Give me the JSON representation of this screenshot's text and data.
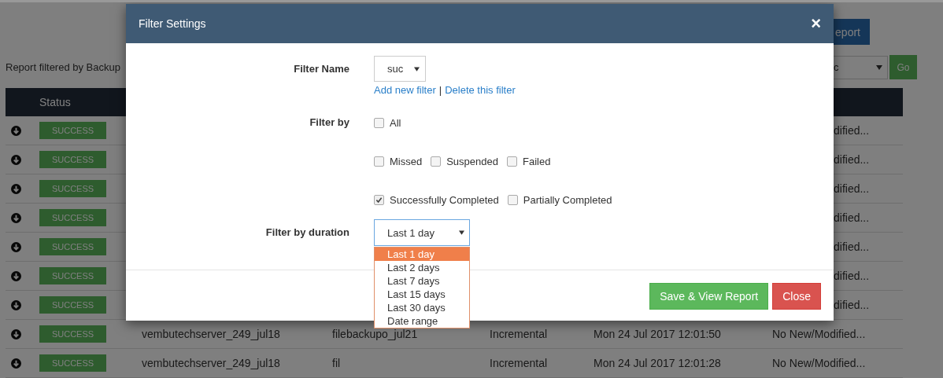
{
  "page": {
    "report_button": "eport",
    "caption": "Report filtered by Backup",
    "filter_select": "c",
    "go_button": "Go"
  },
  "table": {
    "status_heading": "Status",
    "rows": [
      {
        "status": "SUCCESS",
        "column_7": "dified..."
      },
      {
        "status": "SUCCESS",
        "column_7": "dified..."
      },
      {
        "status": "SUCCESS",
        "column_7": "dified..."
      },
      {
        "status": "SUCCESS",
        "column_7": "dified..."
      },
      {
        "status": "SUCCESS",
        "column_7": "dified..."
      },
      {
        "status": "SUCCESS",
        "column_7": "dified..."
      },
      {
        "status": "SUCCESS",
        "column_7": "dified..."
      },
      {
        "status": "SUCCESS",
        "column_3": "vembutechserver_249_jul18",
        "column_4": "filebackupo_jul21",
        "column_5": "Incremental",
        "column_6": "Mon 24 Jul 2017 12:01:50",
        "column_7": "No New/Modified..."
      },
      {
        "status": "SUCCESS",
        "column_3": "vembutechserver_249_jul18",
        "column_4": "fil",
        "column_5": "Incremental",
        "column_6": "Mon 24 Jul 2017 12:01:28",
        "column_7": "No New/Modified..."
      }
    ]
  },
  "modal": {
    "title": "Filter Settings",
    "close": "×",
    "filter_name": {
      "label": "Filter Name",
      "value": "suc",
      "links": [
        "Add new filter",
        "Delete this filter"
      ],
      "separator": "|"
    },
    "filter_by": {
      "label": "Filter by",
      "rows": [
        {
          "options": [
            {
              "label": "All",
              "checked": false
            }
          ]
        },
        {
          "options": [
            {
              "label": "Missed",
              "checked": false
            },
            {
              "label": "Suspended",
              "checked": false
            },
            {
              "label": "Failed",
              "checked": false
            }
          ]
        },
        {
          "options": [
            {
              "label": "Successfully Completed",
              "checked": true
            },
            {
              "label": "Partially Completed",
              "checked": false
            }
          ]
        }
      ]
    },
    "duration": {
      "label": "Filter by duration",
      "value": "Last 1 day",
      "options": [
        {
          "label": "Last 1 day",
          "selected": true
        },
        {
          "label": "Last 2 days",
          "selected": false
        },
        {
          "label": "Last 7 days",
          "selected": false
        },
        {
          "label": "Last 15 days",
          "selected": false
        },
        {
          "label": "Last 30 days",
          "selected": false
        },
        {
          "label": "Date range",
          "selected": false
        }
      ]
    },
    "buttons": [
      {
        "label": "Save & View Report",
        "kind": "primary"
      },
      {
        "label": "Close",
        "kind": "danger"
      }
    ]
  }
}
